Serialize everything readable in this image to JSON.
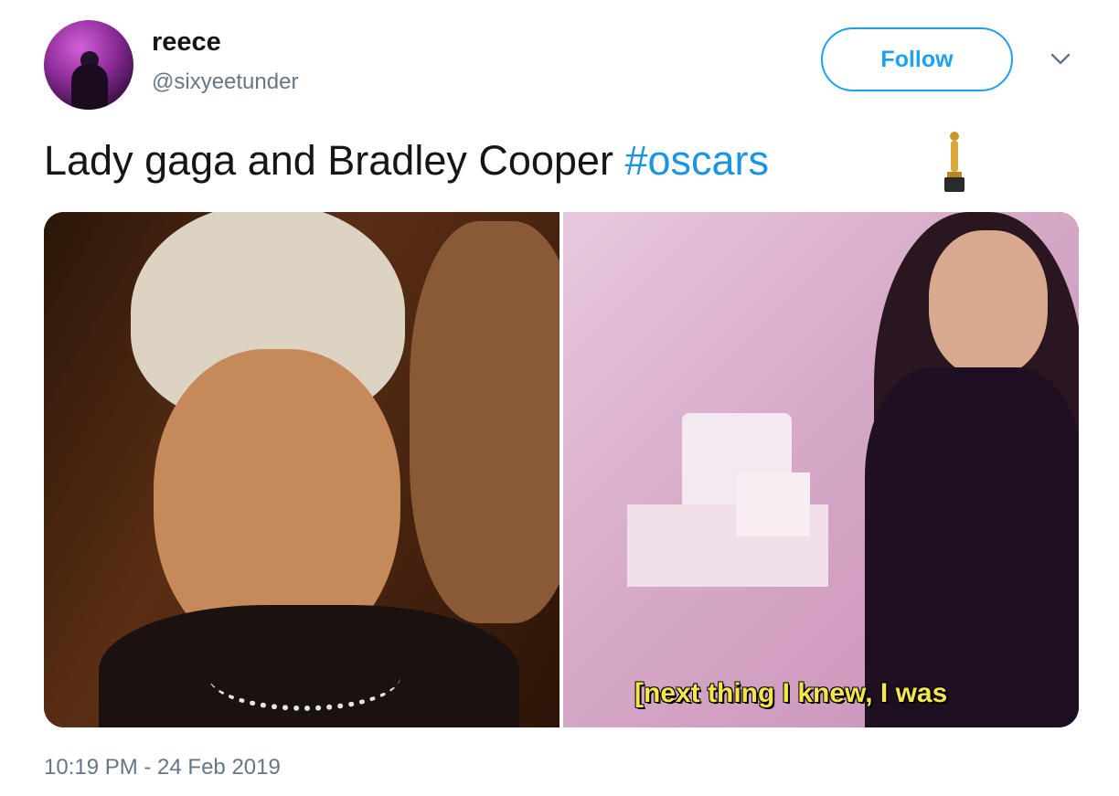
{
  "user": {
    "name": "reece",
    "handle": "@sixyeetunder"
  },
  "follow_label": "Follow",
  "tweet": {
    "text": "Lady gaga and Bradley Cooper ",
    "hashtag": "#oscars",
    "emoji_icon": "oscar-statuette-icon"
  },
  "media": {
    "right_caption": "[next thing I knew, I was"
  },
  "timestamp": "10:19 PM - 24 Feb 2019",
  "colors": {
    "accent": "#1da1f2",
    "hashtag": "#1b95e0",
    "secondary_text": "#657786",
    "caption": "#f5e64a"
  }
}
